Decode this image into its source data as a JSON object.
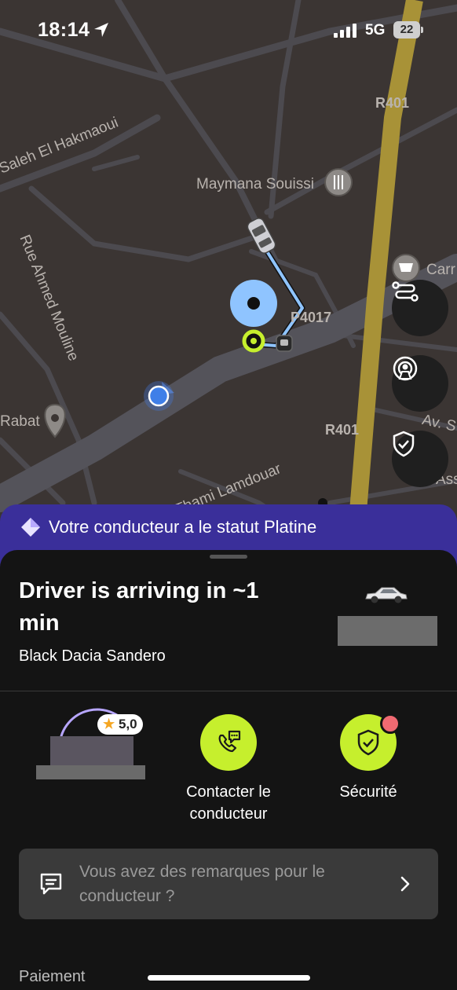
{
  "status_bar": {
    "time": "18:14",
    "network": "5G",
    "battery": "22"
  },
  "map": {
    "street_labels": [
      "Saleh El Hakmaoui",
      "Maymana Souissi",
      "Rue Ahmed Mouline",
      "Thami Lamdouar",
      "Rabat",
      "Carr",
      "Av. S",
      "Ass"
    ],
    "road_numbers": [
      "R401",
      "P4017",
      "R401"
    ],
    "route_color": "#8fc4ff",
    "pickup_color": "#c6ef2d"
  },
  "map_controls": {
    "route_icon": "route-icon",
    "broadcast_icon": "broadcast-icon",
    "safety_icon": "shield-icon"
  },
  "promo": {
    "text": "Votre conducteur a le statut Platine",
    "color": "#3a2f9a"
  },
  "trip": {
    "arriving_title": "Driver is arriving in ~1 min",
    "car_description": "Black Dacia Sandero"
  },
  "driver": {
    "rating": "5,0"
  },
  "actions": {
    "contact_label": "Contacter le conducteur",
    "safety_label": "Sécurité",
    "accent": "#c6ef2d"
  },
  "feedback": {
    "placeholder": "Vous avez des remarques pour le conducteur ?"
  },
  "payment": {
    "label": "Paiement"
  }
}
